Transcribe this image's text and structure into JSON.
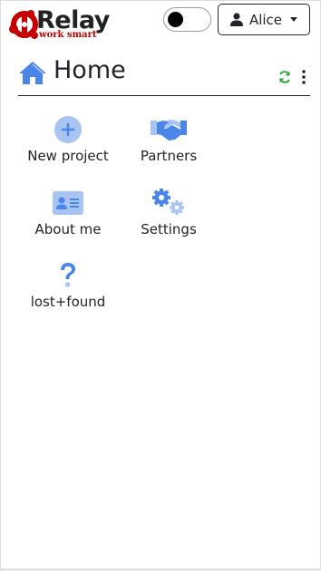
{
  "brand": {
    "name": "Relay",
    "tagline": "work smart"
  },
  "header": {
    "user_label": "Alice",
    "theme_toggle_on": false
  },
  "page": {
    "title": "Home"
  },
  "tiles": [
    {
      "label": "New project",
      "icon": "plus-circle-icon"
    },
    {
      "label": "Partners",
      "icon": "handshake-icon"
    },
    {
      "label": "About me",
      "icon": "id-card-icon"
    },
    {
      "label": "Settings",
      "icon": "gears-icon"
    },
    {
      "label": "lost+found",
      "icon": "question-icon"
    }
  ],
  "colors": {
    "accent": "#4a86e8",
    "accent_light": "#a8c4f2",
    "brand_red": "#c40000",
    "refresh_green": "#2eaa3a"
  }
}
